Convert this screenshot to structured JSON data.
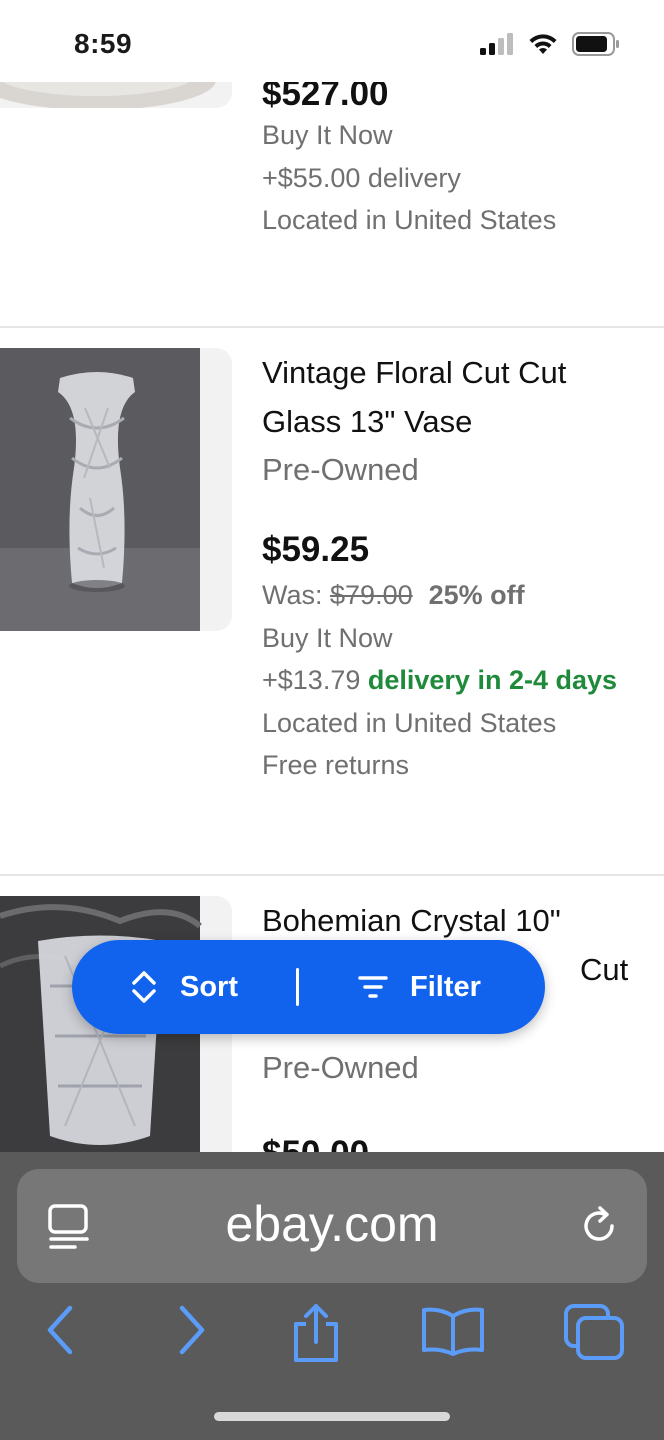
{
  "status": {
    "time": "8:59"
  },
  "listings": [
    {
      "price": "$527.00",
      "buy_format": "Buy It Now",
      "delivery": "+$55.00 delivery",
      "location": "Located in United States"
    },
    {
      "title": "Vintage Floral Cut Cut Glass 13\" Vase",
      "condition": "Pre-Owned",
      "price": "$59.25",
      "was_label": "Was:",
      "was_price": "$79.00",
      "discount": "25% off",
      "buy_format": "Buy It Now",
      "delivery_cost": "+$13.79",
      "delivery_speed": "delivery in 2-4 days",
      "location": "Located in United States",
      "returns": "Free returns"
    },
    {
      "title_line1": "Bohemian Crystal 10\"",
      "title_line2_visible": "Cut",
      "condition": "Pre-Owned",
      "price_partial": "$50.00"
    }
  ],
  "actions": {
    "sort_label": "Sort",
    "filter_label": "Filter"
  },
  "browser": {
    "url": "ebay.com"
  },
  "colors": {
    "accent": "#1163ee",
    "delivery_green": "#1f8a3a",
    "chrome_bg": "#5a5a5b",
    "toolbar_icon": "#5a9cf8"
  },
  "icons": [
    "signal-icon",
    "wifi-icon",
    "battery-icon",
    "sort-icon",
    "filter-icon",
    "reader-icon",
    "reload-icon",
    "back-icon",
    "forward-icon",
    "share-icon",
    "bookmarks-icon",
    "tabs-icon"
  ]
}
